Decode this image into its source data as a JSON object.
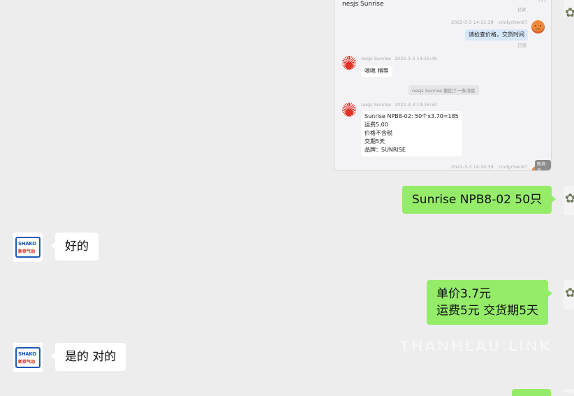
{
  "screenshot": {
    "title": "nesjs Sunrise",
    "top_read": "已读",
    "messages": [
      {
        "meta": "2022-3-3 14:15:38",
        "sender": "cindychen97",
        "text": "请检查价格，交货时间",
        "status": "已读"
      },
      {
        "sender": "nesjs Sunrise",
        "meta": "2022-3-3 14:15:49",
        "text": "嗯嗯 稍等"
      },
      {
        "system": "nesjs Sunrise 撤回了一条消息"
      },
      {
        "sender": "nesjs Sunrise",
        "meta": "2022-3-3 14:16:50",
        "lines": [
          "Sunrise NPB8-02: 50个x3.70=185",
          "运费5.00",
          "价格不含税",
          "交期5天",
          "品牌：SUNRISE"
        ]
      },
      {
        "meta": "2022-3-3 14:20:39",
        "sender": "cindychen97",
        "badge": "新消息"
      }
    ]
  },
  "chat": {
    "msg1": "Sunrise NPB8-02 50只",
    "reply1": "好的",
    "msg2_lines": [
      "单价3.7元",
      "运费5元 交货期5天"
    ],
    "reply2": "是的 对的"
  },
  "contact_avatar": {
    "brand_line1": "SHAKO",
    "brand_line2": "新恭气动"
  },
  "watermark": "THANHLAU.LINK"
}
